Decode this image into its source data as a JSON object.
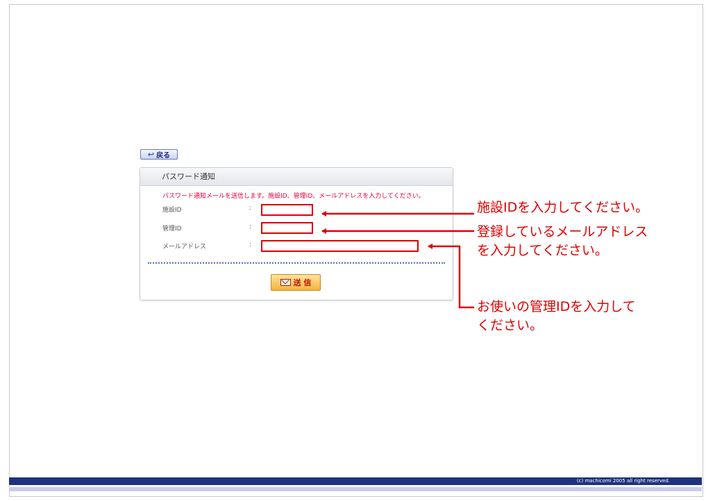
{
  "back_button": {
    "label": "戻る"
  },
  "panel": {
    "title": "パスワード通知",
    "instruction": "パスワード通知メールを送信します。施設ID、管理ID、メールアドレスを入力してください。",
    "fields": [
      {
        "label": "施設ID",
        "colon": ":",
        "value": ""
      },
      {
        "label": "管理ID",
        "colon": ":",
        "value": ""
      },
      {
        "label": "メールアドレス",
        "colon": ":",
        "value": ""
      }
    ],
    "send_button": {
      "label": "送 信"
    }
  },
  "annotations": [
    {
      "text": "施設IDを入力してください。"
    },
    {
      "text_line1": "登録しているメールアドレス",
      "text_line2": "を入力してください。"
    },
    {
      "text_line1": "お使いの管理IDを入力して",
      "text_line2": "ください。"
    }
  ],
  "annotation_color": "#e00000",
  "footer": {
    "copyright": "(c) machicomi 2005 all right reserved."
  },
  "colors": {
    "footer_bar": "#1e3280",
    "instruction_text": "#e0003c",
    "send_button": "#f4b43c"
  }
}
